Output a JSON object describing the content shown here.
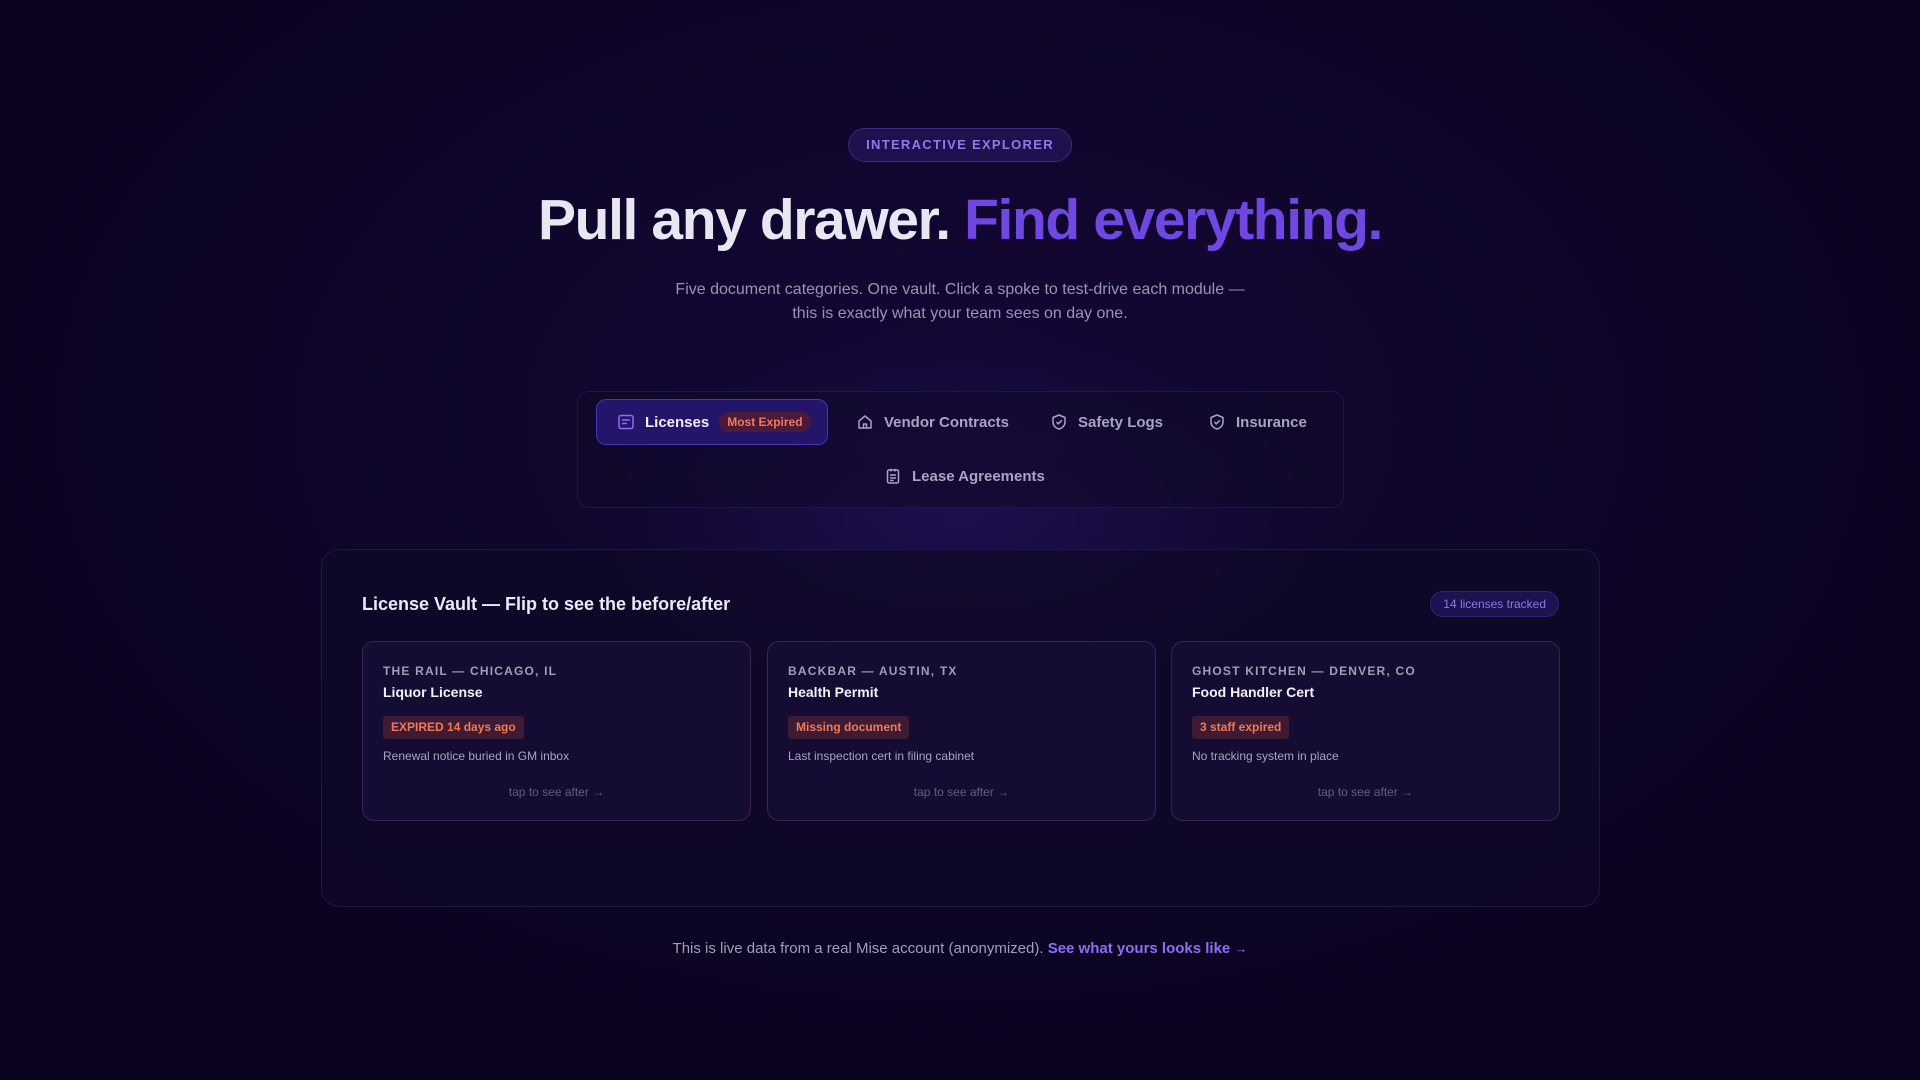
{
  "hero": {
    "eyebrow": "INTERACTIVE EXPLORER",
    "headline_plain": "Pull any drawer.",
    "headline_accent": "Find everything.",
    "subtitle_line1": "Five document categories. One vault. Click a spoke to test-drive each module —",
    "subtitle_line2": "this is exactly what your team sees on day one."
  },
  "tabs": [
    {
      "label": "Licenses",
      "badge": "Most Expired",
      "icon": "license-icon",
      "active": true
    },
    {
      "label": "Vendor Contracts",
      "icon": "home-icon",
      "active": false
    },
    {
      "label": "Safety Logs",
      "icon": "shield-check-icon",
      "active": false
    },
    {
      "label": "Insurance",
      "icon": "shield-check-icon",
      "active": false
    },
    {
      "label": "Lease Agreements",
      "icon": "clipboard-icon",
      "active": false
    }
  ],
  "vault": {
    "title": "License Vault — Flip to see the before/after",
    "tracked": "14 licenses tracked",
    "cards": [
      {
        "location": "THE RAIL — CHICAGO, IL",
        "document": "Liquor License",
        "status": "EXPIRED 14 days ago",
        "note": "Renewal notice buried in GM inbox",
        "hint": "tap to see after →"
      },
      {
        "location": "BACKBAR — AUSTIN, TX",
        "document": "Health Permit",
        "status": "Missing document",
        "note": "Last inspection cert in filing cabinet",
        "hint": "tap to see after →"
      },
      {
        "location": "GHOST KITCHEN — DENVER, CO",
        "document": "Food Handler Cert",
        "status": "3 staff expired",
        "note": "No tracking system in place",
        "hint": "tap to see after →"
      }
    ]
  },
  "footer": {
    "text": "This is live data from a real Mise account (anonymized).",
    "cta": "See what yours looks like",
    "arrow": "→"
  },
  "colors": {
    "background": "#0b0320",
    "accent": "#7047e0",
    "expired": "#f07a55"
  }
}
